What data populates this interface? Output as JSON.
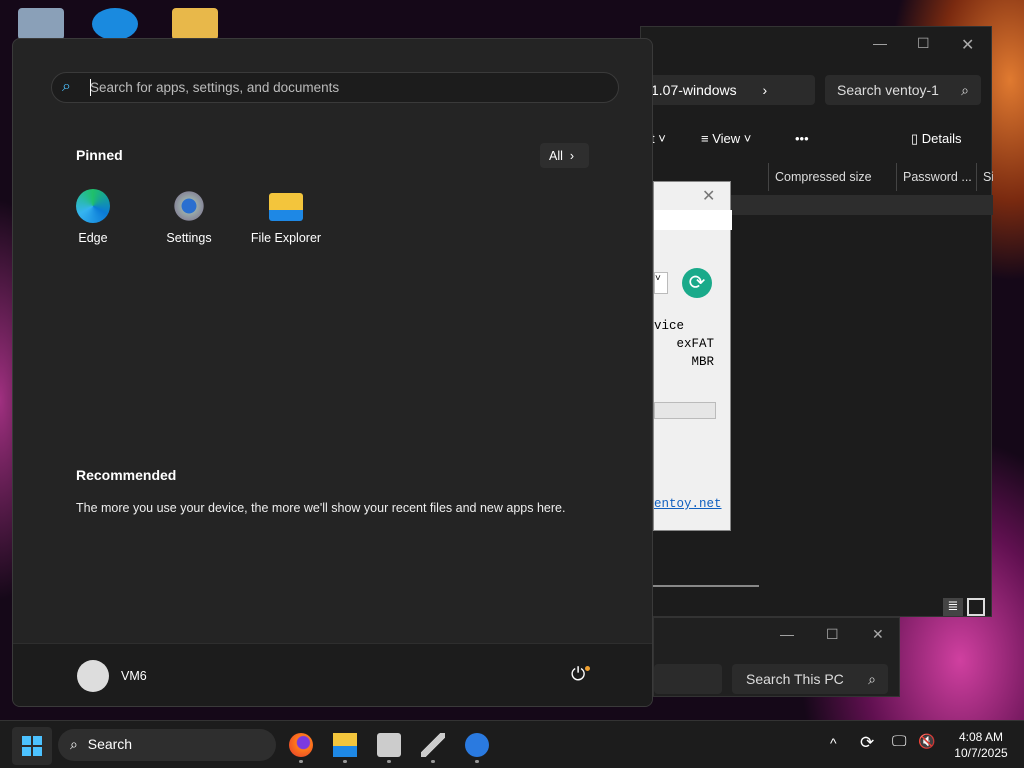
{
  "explorer": {
    "address": "1.07-windows",
    "search_placeholder": "Search ventoy-1",
    "toolbar": {
      "sort_fragment": "t",
      "view": "View",
      "more": "•••",
      "details": "Details"
    },
    "columns": [
      "Compressed size",
      "Password ...",
      "Si"
    ]
  },
  "ventoy": {
    "device_label": "vice",
    "fs": "exFAT",
    "partition": "MBR",
    "link": "entoy.net",
    "accent": "#1aaa8a"
  },
  "this_pc": {
    "search_placeholder": "Search This PC"
  },
  "start_menu": {
    "search_placeholder": "Search for apps, settings, and documents",
    "pinned_title": "Pinned",
    "all_button": "All",
    "pinned": [
      {
        "label": "Edge",
        "icon": "edge-icon"
      },
      {
        "label": "Settings",
        "icon": "gear-icon"
      },
      {
        "label": "File Explorer",
        "icon": "folder-icon"
      }
    ],
    "recommended_title": "Recommended",
    "recommended_text": "The more you use your device, the more we'll show your recent files and new apps here.",
    "user": "VM6"
  },
  "taskbar": {
    "search": "Search",
    "apps": [
      "firefox-icon",
      "file-explorer-icon",
      "package-icon",
      "usb-icon",
      "app-icon"
    ],
    "time": "4:08 AM",
    "date": "10/7/2025"
  }
}
